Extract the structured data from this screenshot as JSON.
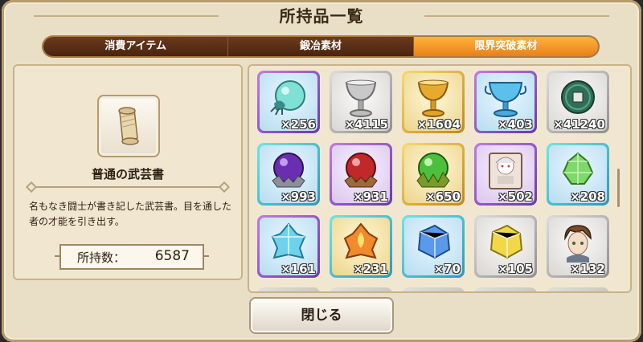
{
  "window": {
    "title": "所持品一覧"
  },
  "tabs": [
    {
      "label": "消費アイテム",
      "active": false
    },
    {
      "label": "鍛冶素材",
      "active": false
    },
    {
      "label": "限界突破素材",
      "active": true
    }
  ],
  "detail": {
    "icon": "scroll-icon",
    "name": "普通の武芸書",
    "description": "名もなき闘士が書き記した武芸書。目を通した者の才能を引き出す。",
    "count_label": "所持数：",
    "count_value": "6587"
  },
  "items": [
    {
      "quantity": "×256",
      "icon": "ghost-orb-icon",
      "rarity": "purple",
      "color": "#5fd0c8"
    },
    {
      "quantity": "×4115",
      "icon": "silver-goblet-icon",
      "rarity": "silver",
      "color": "#a8a8a8"
    },
    {
      "quantity": "×1604",
      "icon": "gold-goblet-icon",
      "rarity": "gold",
      "color": "#d9a026"
    },
    {
      "quantity": "×403",
      "icon": "blue-crystal-goblet-icon",
      "rarity": "purple",
      "color": "#4ab3d9"
    },
    {
      "quantity": "×41240",
      "icon": "jade-coin-icon",
      "rarity": "silver",
      "color": "#2f6f5a"
    },
    {
      "quantity": "×993",
      "icon": "purple-orb-icon",
      "rarity": "cyan",
      "color": "#6a2fb0"
    },
    {
      "quantity": "×931",
      "icon": "red-orb-icon",
      "rarity": "purple",
      "color": "#c0282a"
    },
    {
      "quantity": "×650",
      "icon": "green-orb-icon",
      "rarity": "gold",
      "color": "#4cc03a"
    },
    {
      "quantity": "×502",
      "icon": "character-card-icon",
      "rarity": "purple",
      "color": "#e4c9c4"
    },
    {
      "quantity": "×208",
      "icon": "green-crystal-icon",
      "rarity": "cyan",
      "color": "#7ed86a"
    },
    {
      "quantity": "×161",
      "icon": "ice-crystal-icon",
      "rarity": "purple",
      "color": "#6fd2ea"
    },
    {
      "quantity": "×231",
      "icon": "flame-crystal-icon",
      "rarity": "cyan",
      "color": "#f08a2a"
    },
    {
      "quantity": "×70",
      "icon": "blue-crystal-icon",
      "rarity": "cyan",
      "color": "#5a9ae8"
    },
    {
      "quantity": "×105",
      "icon": "yellow-crystal-icon",
      "rarity": "silver",
      "color": "#f0d84a"
    },
    {
      "quantity": "×132",
      "icon": "hero-portrait-icon",
      "rarity": "silver",
      "color": "#7a4a2a"
    }
  ],
  "close_button": {
    "label": "閉じる"
  }
}
